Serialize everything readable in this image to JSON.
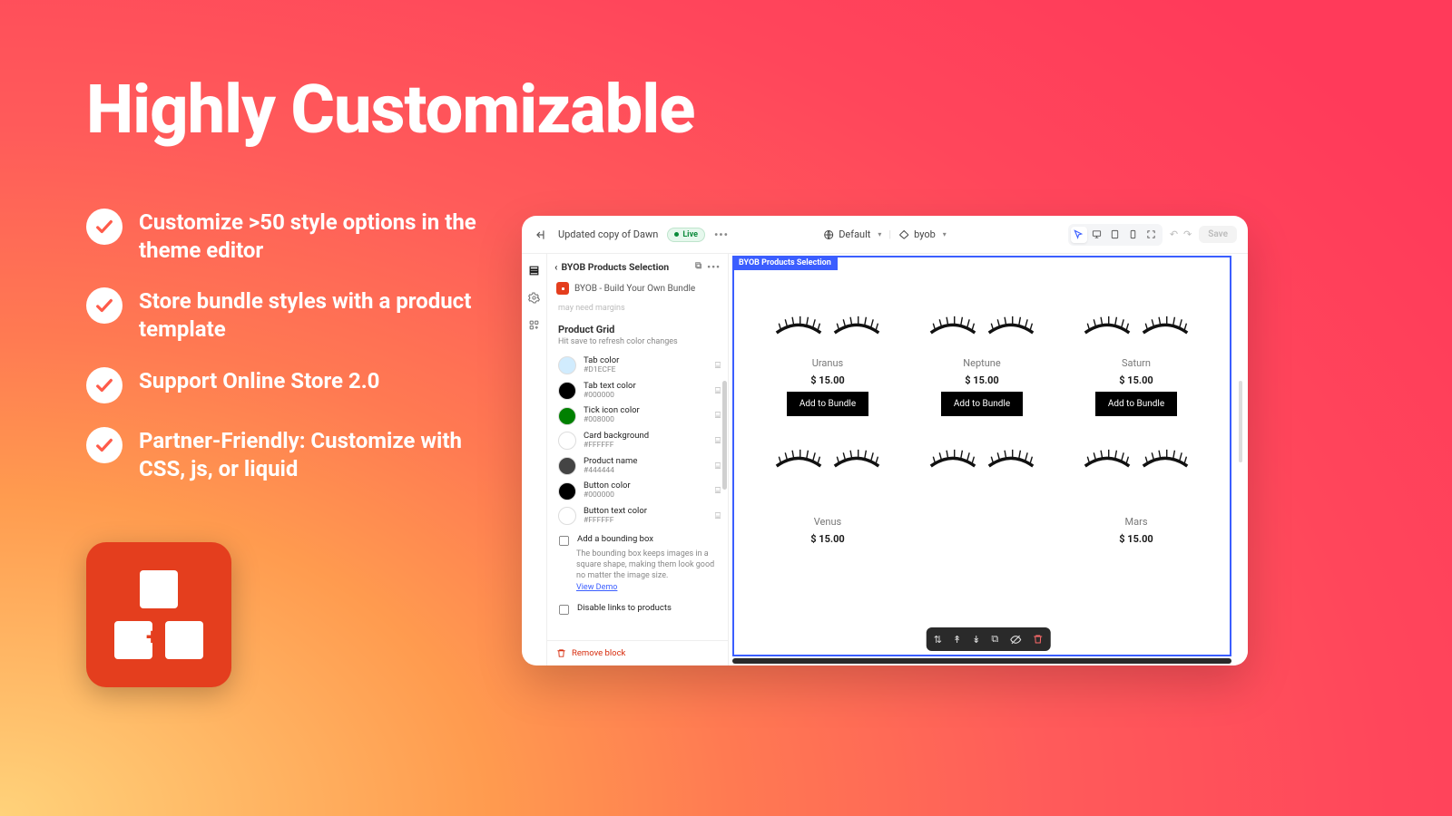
{
  "hero": {
    "title": "Highly Customizable"
  },
  "bullets": [
    "Customize >50 style options in the theme editor",
    "Store bundle styles with a product template",
    "Support Online Store 2.0",
    "Partner-Friendly: Customize with CSS, js, or liquid"
  ],
  "topbar": {
    "theme_name": "Updated copy of Dawn",
    "live_label": "Live",
    "template_label": "Default",
    "page_label": "byob",
    "save_label": "Save"
  },
  "config": {
    "title": "BYOB Products Selection",
    "app_name": "BYOB - Build Your Own Bundle",
    "faint_hint": "may need margins",
    "section_title": "Product Grid",
    "hint": "Hit save to refresh color changes",
    "colors": [
      {
        "label": "Tab color",
        "hex": "#D1ECFE",
        "swatch": "#D1ECFE"
      },
      {
        "label": "Tab text color",
        "hex": "#000000",
        "swatch": "#000000"
      },
      {
        "label": "Tick icon color",
        "hex": "#008000",
        "swatch": "#008000"
      },
      {
        "label": "Card background",
        "hex": "#FFFFFF",
        "swatch": "#FFFFFF"
      },
      {
        "label": "Product name",
        "hex": "#444444",
        "swatch": "#444444"
      },
      {
        "label": "Button color",
        "hex": "#000000",
        "swatch": "#000000"
      },
      {
        "label": "Button text color",
        "hex": "#FFFFFF",
        "swatch": "#FFFFFF"
      }
    ],
    "bounding_label": "Add a bounding box",
    "bounding_help": "The bounding box keeps images in a square shape, making them look good no matter the image size.",
    "view_demo": "View Demo",
    "disable_links_label": "Disable links to products",
    "remove_block": "Remove block"
  },
  "preview": {
    "section_label": "BYOB Products Selection",
    "add_label": "Add to Bundle",
    "row1": [
      {
        "name": "Uranus",
        "price": "$ 15.00"
      },
      {
        "name": "Neptune",
        "price": "$ 15.00"
      },
      {
        "name": "Saturn",
        "price": "$ 15.00"
      }
    ],
    "row2": [
      {
        "name": "Venus",
        "price": "$ 15.00"
      },
      {
        "name": "",
        "price": ""
      },
      {
        "name": "Mars",
        "price": "$ 15.00"
      }
    ]
  }
}
